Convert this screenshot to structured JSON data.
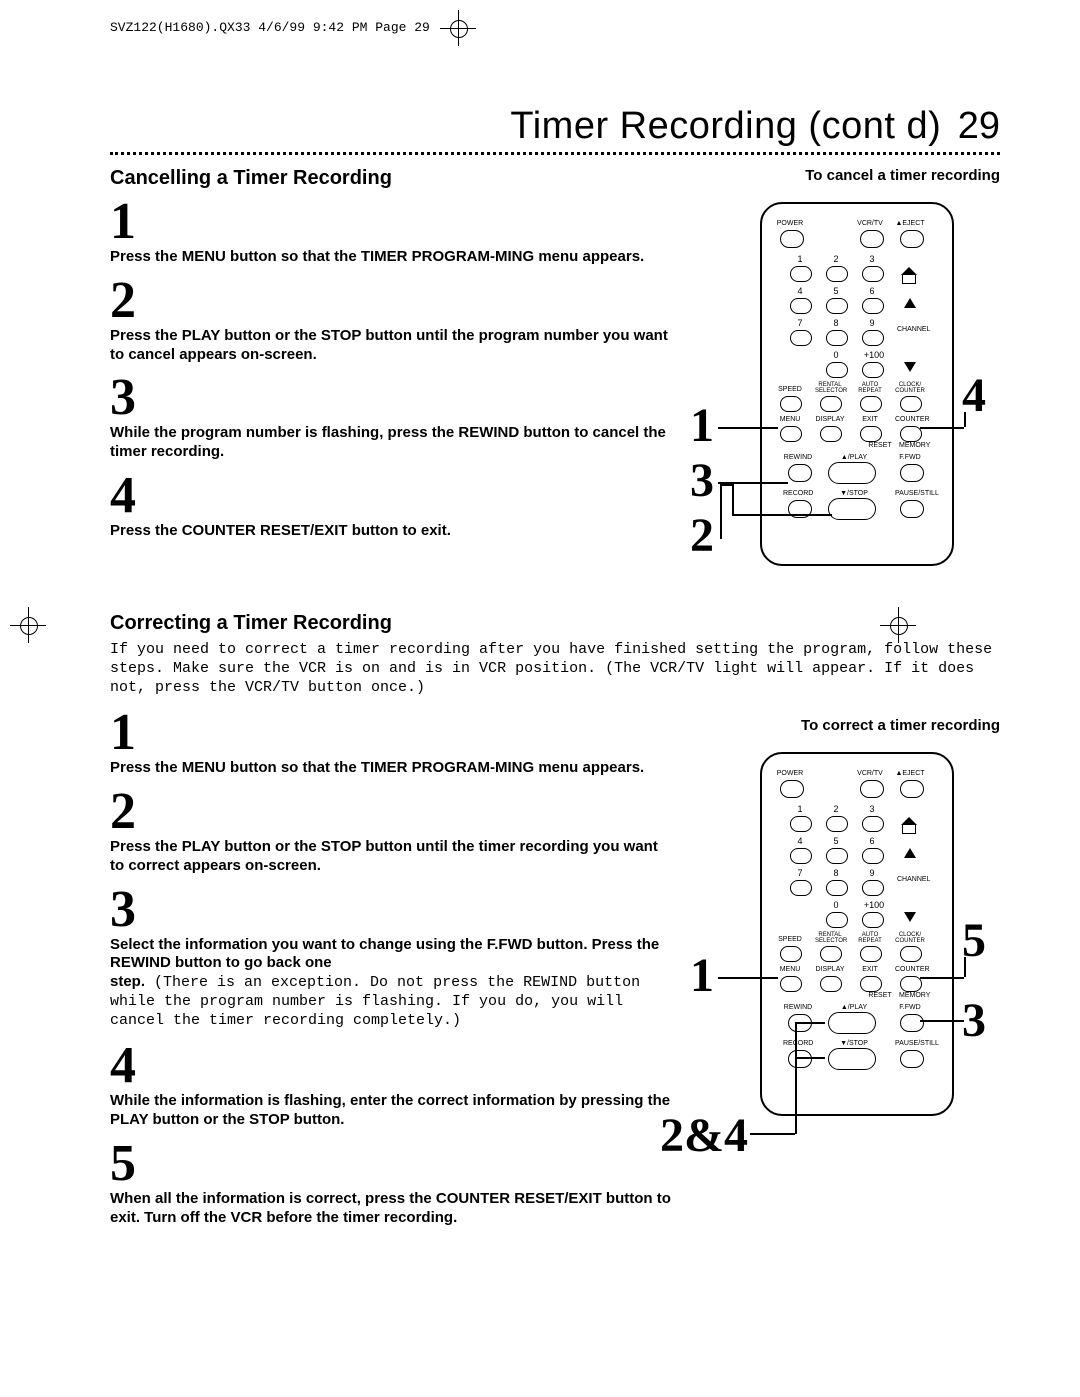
{
  "header": "SVZ122(H1680).QX33  4/6/99 9:42 PM  Page 29",
  "page_title": "Timer Recording (cont d)",
  "page_number": "29",
  "cancel": {
    "section_title": "Cancelling a Timer Recording",
    "remote_caption": "To cancel a timer recording",
    "steps": {
      "n1": "1",
      "t1": "Press the MENU button so that the TIMER PROGRAM-MING menu appears.",
      "n2": "2",
      "t2": "Press the PLAY button or the STOP button until the program number you want to cancel appears on-screen.",
      "n3": "3",
      "t3": "While the program number is flashing, press the REWIND button to cancel the timer recording.",
      "n4": "4",
      "t4": "Press the COUNTER RESET/EXIT button to exit."
    },
    "callouts": {
      "c1": "1",
      "c2": "2",
      "c3": "3",
      "c4": "4"
    }
  },
  "correct": {
    "section_title": "Correcting a Timer Recording",
    "intro": "If you need to correct a timer recording after you have finished setting the program, follow these steps. Make sure the VCR is on and is in VCR position. (The VCR/TV light will appear. If it does not, press the VCR/TV button once.)",
    "remote_caption": "To correct a timer recording",
    "steps": {
      "n1": "1",
      "t1": "Press the MENU button so that the TIMER PROGRAM-MING menu appears.",
      "n2": "2",
      "t2": "Press the PLAY button or the STOP button until the timer recording you want to correct appears on-screen.",
      "n3": "3",
      "t3a": "Select the information you want to change using the F.FWD button. Press the REWIND button to go back one",
      "t3b": "step.",
      "t3c": " (There is an exception. Do not press the REWIND button while the program number is flashing. If you do, you will cancel the timer recording completely.)",
      "n4": "4",
      "t4": "While the information is flashing, enter the correct information by pressing the PLAY button or the STOP button.",
      "n5": "5",
      "t5": "When all the information is correct, press the COUNTER RESET/EXIT button to exit. Turn off the VCR before the timer recording."
    },
    "callouts": {
      "c1": "1",
      "c24": "2&4",
      "c3": "3",
      "c5": "5"
    }
  },
  "remote_labels": {
    "power": "POWER",
    "vcrtv": "VCR/TV",
    "eject": "▲EJECT",
    "channel": "CHANNEL",
    "speed": "SPEED",
    "rental": "RENTAL SELECTOR",
    "auto": "AUTO REPEAT",
    "clock": "CLOCK/ COUNTER",
    "menu": "MENU",
    "display": "DISPLAY",
    "exit": "EXIT",
    "counter": "COUNTER",
    "reset": "RESET",
    "memory": "MEMORY",
    "rewind": "REWIND",
    "play": "▲/PLAY",
    "ffwd": "F.FWD",
    "record": "RECORD",
    "stop": "▼/STOP",
    "pause": "PAUSE/STILL",
    "plus100": "+100",
    "k0": "0",
    "k1": "1",
    "k2": "2",
    "k3": "3",
    "k4": "4",
    "k5": "5",
    "k6": "6",
    "k7": "7",
    "k8": "8",
    "k9": "9"
  }
}
